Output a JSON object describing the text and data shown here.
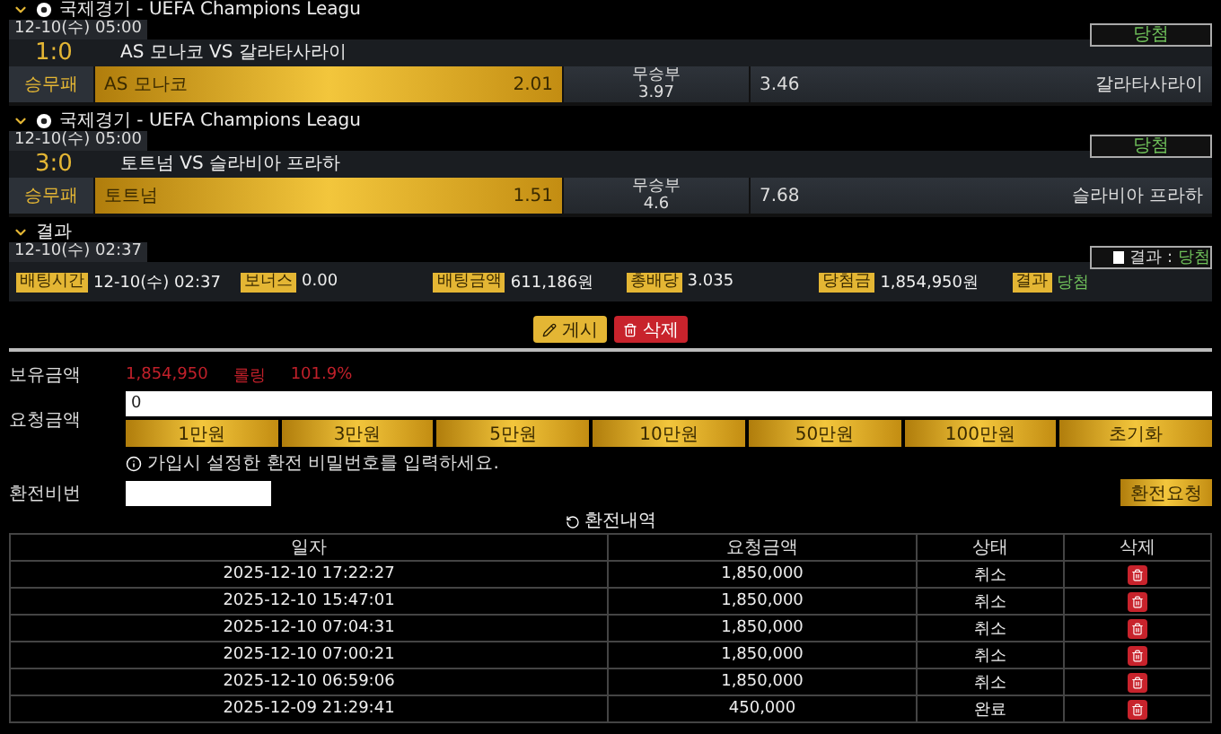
{
  "matches": [
    {
      "league": "국제경기 - UEFA Champions Leagu",
      "datetime": "12-10(수) 05:00",
      "status": "당첨",
      "score": "1:0",
      "teams": "AS 모나코 VS 갈라타사라이",
      "market": "승무패",
      "options": [
        {
          "kind": "home",
          "label": "AS 모나코",
          "odds": "2.01",
          "selected": true
        },
        {
          "kind": "draw",
          "label": "무승부",
          "odds": "3.97",
          "selected": false
        },
        {
          "kind": "away",
          "label": "갈라타사라이",
          "odds": "3.46",
          "selected": false
        }
      ]
    },
    {
      "league": "국제경기 - UEFA Champions Leagu",
      "datetime": "12-10(수) 05:00",
      "status": "당첨",
      "score": "3:0",
      "teams": "토트넘 VS 슬라비아 프라하",
      "market": "승무패",
      "options": [
        {
          "kind": "home",
          "label": "토트넘",
          "odds": "1.51",
          "selected": true
        },
        {
          "kind": "draw",
          "label": "무승부",
          "odds": "4.6",
          "selected": false
        },
        {
          "kind": "away",
          "label": "슬라비아 프라하",
          "odds": "7.68",
          "selected": false
        }
      ]
    }
  ],
  "result": {
    "title": "결과",
    "datetime": "12-10(수) 02:37",
    "badge": {
      "checked": false,
      "label": "결과 :",
      "value": "당첨"
    },
    "fields": [
      {
        "label": "배팅시간",
        "value": "12-10(수) 02:37",
        "kind": "plain"
      },
      {
        "label": "보너스",
        "value": "0.00",
        "kind": "plain"
      },
      {
        "label": "배팅금액",
        "value": "611,186원",
        "kind": "plain"
      },
      {
        "label": "총배당",
        "value": "3.035",
        "kind": "plain"
      },
      {
        "label": "당첨금",
        "value": "1,854,950원",
        "kind": "plain"
      },
      {
        "label": "결과",
        "value": "당첨",
        "kind": "outcome"
      }
    ]
  },
  "actions": [
    {
      "kind": "post",
      "label": "게시"
    },
    {
      "kind": "delete",
      "label": "삭제"
    }
  ],
  "wallet": {
    "balance_label": "보유금액",
    "balance": "1,854,950",
    "rolling_label": "롤링",
    "rolling": "101.9%",
    "amount_label": "요청금액",
    "amount": "0",
    "quick_amounts": [
      "1만원",
      "3만원",
      "5만원",
      "10만원",
      "50만원",
      "100만원",
      "초기화"
    ],
    "notice": "가입시 설정한 환전 비밀번호를 입력하세요.",
    "password_label": "환전비번",
    "submit": "환전요청"
  },
  "history": {
    "title": "환전내역",
    "columns": [
      "일자",
      "요청금액",
      "상태",
      "삭제"
    ],
    "rows": [
      {
        "date": "2025-12-10 17:22:27",
        "amount": "1,850,000",
        "status": "취소"
      },
      {
        "date": "2025-12-10 15:47:01",
        "amount": "1,850,000",
        "status": "취소"
      },
      {
        "date": "2025-12-10 07:04:31",
        "amount": "1,850,000",
        "status": "취소"
      },
      {
        "date": "2025-12-10 07:00:21",
        "amount": "1,850,000",
        "status": "취소"
      },
      {
        "date": "2025-12-10 06:59:06",
        "amount": "1,850,000",
        "status": "취소"
      },
      {
        "date": "2025-12-09 21:29:41",
        "amount": "450,000",
        "status": "완료"
      }
    ]
  }
}
